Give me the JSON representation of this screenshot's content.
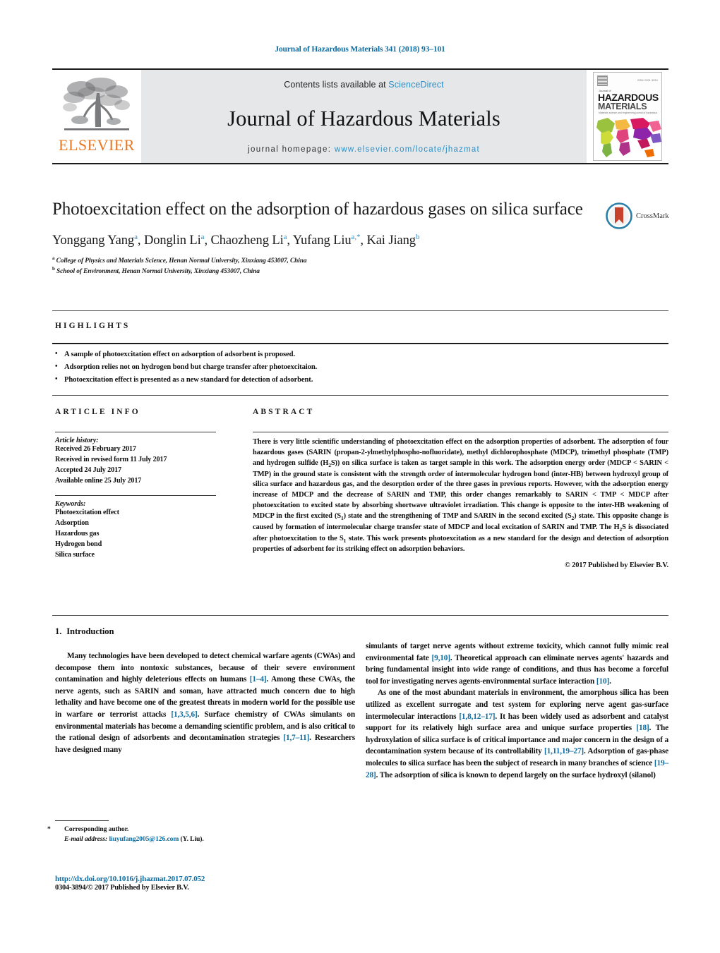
{
  "running_head": "Journal of Hazardous Materials 341 (2018) 93–101",
  "masthead": {
    "contents_prefix": "Contents lists available at ",
    "sciencedirect": "ScienceDirect",
    "journal_title": "Journal of Hazardous Materials",
    "homepage_prefix": "journal homepage: ",
    "homepage_url": "www.elsevier.com/locate/jhazmat",
    "publisher": "ELSEVIER",
    "cover": {
      "kicker": "Journal of",
      "line1": "HAZARDOUS",
      "line2": "MATERIALS",
      "subtitle": "Materials science and engineering journal of hazardous substances",
      "issn": "ISSN 0304-3894"
    },
    "accent_blue": "#2a8fc9",
    "elsevier_orange": "#e87722",
    "band_gray": "#e6e7e8"
  },
  "article": {
    "title": "Photoexcitation effect on the adsorption of hazardous gases on silica surface",
    "authors": [
      {
        "name": "Yonggang Yang",
        "sup": "a"
      },
      {
        "name": "Donglin Li",
        "sup": "a"
      },
      {
        "name": "Chaozheng Li",
        "sup": "a"
      },
      {
        "name": "Yufang Liu",
        "sup": "a,*"
      },
      {
        "name": "Kai Jiang",
        "sup": "b"
      }
    ],
    "affiliations": [
      {
        "sup": "a",
        "text": "College of Physics and Materials Science, Henan Normal University, Xinxiang 453007, China"
      },
      {
        "sup": "b",
        "text": "School of Environment, Henan Normal University, Xinxiang 453007, China"
      }
    ],
    "crossmark_label": "CrossMark"
  },
  "highlights": {
    "heading": "HIGHLIGHTS",
    "items": [
      "A sample of photoexcitation effect on adsorption of adsorbent is proposed.",
      "Adsorption relies not on hydrogen bond but charge transfer after photoexcitaion.",
      "Photoexcitation effect is presented as a new standard for detection of adsorbent."
    ]
  },
  "article_info": {
    "heading": "ARTICLE INFO",
    "history_label": "Article history:",
    "history": [
      "Received 26 February 2017",
      "Received in revised form 11 July 2017",
      "Accepted 24 July 2017",
      "Available online 25 July 2017"
    ],
    "keywords_label": "Keywords:",
    "keywords": [
      "Photoexcitation effect",
      "Adsorption",
      "Hazardous gas",
      "Hydrogen bond",
      "Silica surface"
    ]
  },
  "abstract": {
    "heading": "ABSTRACT",
    "paragraph_1": "There is very little scientific understanding of photoexcitation effect on the adsorption properties of adsorbent. The adsorption of four hazardous gases (SARIN (propan-2-ylmethylphospho-nofluoridate), methyl dichlorophosphate (MDCP), trimethyl phosphate (TMP) and hydrogen sulfide (H",
    "h2s_sub": "2",
    "paragraph_2": "S)) on silica surface is taken as target sample in this work. The adsorption energy order (MDCP < SARIN < TMP) in the ground state is consistent with the strength order of intermolecular hydrogen bond (inter-HB) between hydroxyl group of silica surface and hazardous gas, and the desorption order of the three gases in previous reports. However, with the adsorption energy increase of MDCP and the decrease of SARIN and TMP, this order changes remarkably to SARIN < TMP < MDCP after photoexcitation to excited state by absorbing shortwave ultraviolet irradiation. This change is opposite to the inter-HB weakening of MDCP in the first excited (S",
    "s1_sub": "1",
    "paragraph_3": ") state and the strengthening of TMP and SARIN in the second excited (S",
    "s2_sub": "2",
    "paragraph_4": ") state. This opposite change is caused by formation of intermolecular charge transfer state of MDCP and local excitation of SARIN and TMP. The H",
    "h2s_sub_2": "2",
    "paragraph_5": "S is dissociated after photoexcitation to the S",
    "s1_sub_2": "1",
    "paragraph_6": " state. This work presents photoexcitation as a new standard for the design and detection of adsorption properties of adsorbent for its striking effect on adsorption behaviors.",
    "copyright": "© 2017 Published by Elsevier B.V."
  },
  "introduction": {
    "number": "1.",
    "heading": "Introduction",
    "left_p1_a": "Many technologies have been developed to detect chemical warfare agents (CWAs) and decompose them into nontoxic substances, because of their severe environment contamination and highly deleterious effects on humans ",
    "left_ref1": "[1–4]",
    "left_p1_b": ". Among these CWAs, the nerve agents, such as SARIN and soman, have attracted much concern due to high lethality and have become one of the greatest threats in modern world for the possible use in warfare or terrorist attacks ",
    "left_ref2": "[1,3,5,6]",
    "left_p1_c": ". Surface chemistry of CWAs simulants on environmental materials has become a demanding scientific problem, and is also critical to the rational design of adsorbents and decontamination strategies ",
    "left_ref3": "[1,7–11]",
    "left_p1_d": ". Researchers have designed many",
    "right_p1_a": "simulants of target nerve agents without extreme toxicity, which cannot fully mimic real environmental fate ",
    "right_ref1": "[9,10]",
    "right_p1_b": ". Theoretical approach can eliminate nerves agents' hazards and bring fundamental insight into wide range of conditions, and thus has become a forceful tool for investigating nerves agents-environmental surface interaction ",
    "right_ref2": "[10]",
    "right_p1_c": ".",
    "right_p2_a": "As one of the most abundant materials in environment, the amorphous silica has been utilized as excellent surrogate and test system for exploring nerve agent gas-surface intermolecular interactions ",
    "right_ref3": "[1,8,12–17]",
    "right_p2_b": ". It has been widely used as adsorbent and catalyst support for its relatively high surface area and unique surface properties ",
    "right_ref4": "[18]",
    "right_p2_c": ". The hydroxylation of silica surface is of critical importance and major concern in the design of a decontamination system because of its controllability ",
    "right_ref5": "[1,11,19–27]",
    "right_p2_d": ". Adsorption of gas-phase molecules to silica surface has been the subject of research in many branches of science ",
    "right_ref6": "[19–28]",
    "right_p2_e": ". The adsorption of silica is known to depend largely on the surface hydroxyl (silanol)"
  },
  "footnote": {
    "star": "*",
    "corresponding": "Corresponding author.",
    "email_label": "E-mail address:",
    "email": "liuyufang2005@126.com",
    "email_owner": "(Y. Liu).",
    "doi": "http://dx.doi.org/10.1016/j.jhazmat.2017.07.052",
    "issn_copyright": "0304-3894/© 2017 Published by Elsevier B.V."
  }
}
